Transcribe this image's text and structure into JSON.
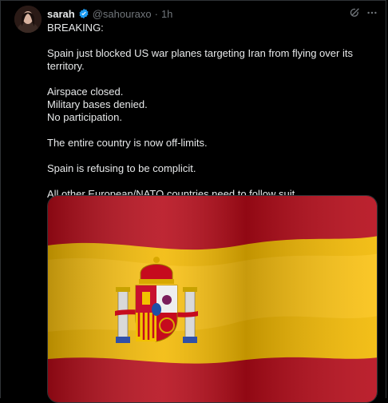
{
  "user": {
    "name": "sarah",
    "handle": "@sahouraxo",
    "separator": "·",
    "time": "1h"
  },
  "tweet": {
    "lines": [
      "BREAKING:",
      "",
      "Spain just blocked US war planes targeting Iran from flying over its territory.",
      "",
      "Airspace closed.",
      "Military bases denied.",
      "No participation.",
      "",
      "The entire country is now off-limits.",
      "",
      "Spain is refusing to be complicit.",
      "",
      "All other European/NATO countries need to follow suit."
    ]
  },
  "icons": {
    "verified": "verified-badge-icon",
    "grok": "grok-icon",
    "more": "more-icon"
  },
  "colors": {
    "verified_blue": "#1d9bf0",
    "flag_red": "#c60b1e",
    "flag_yellow": "#ffc400",
    "text_primary": "#e7e9ea",
    "text_secondary": "#71767b"
  }
}
